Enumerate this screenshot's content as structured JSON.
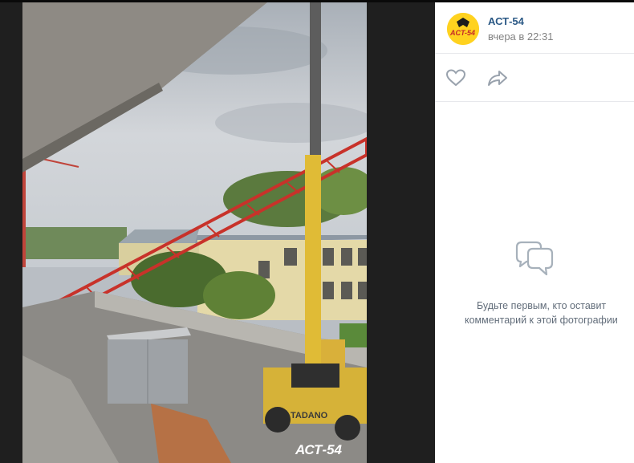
{
  "post": {
    "author": "АСТ-54",
    "date": "вчера в 22:31"
  },
  "photo": {
    "watermark": "АСТ-54",
    "crane_brand": "TADANO"
  },
  "actions": {
    "like_icon": "heart-icon",
    "share_icon": "share-arrow-icon"
  },
  "comments": {
    "empty_icon": "chat-bubbles-icon",
    "empty_line1": "Будьте первым, кто оставит",
    "empty_line2": "комментарий к этой фотографии"
  },
  "colors": {
    "link": "#2a5885",
    "muted": "#828282",
    "icon": "#99a2ad",
    "brand_yellow": "#ffd21f"
  }
}
